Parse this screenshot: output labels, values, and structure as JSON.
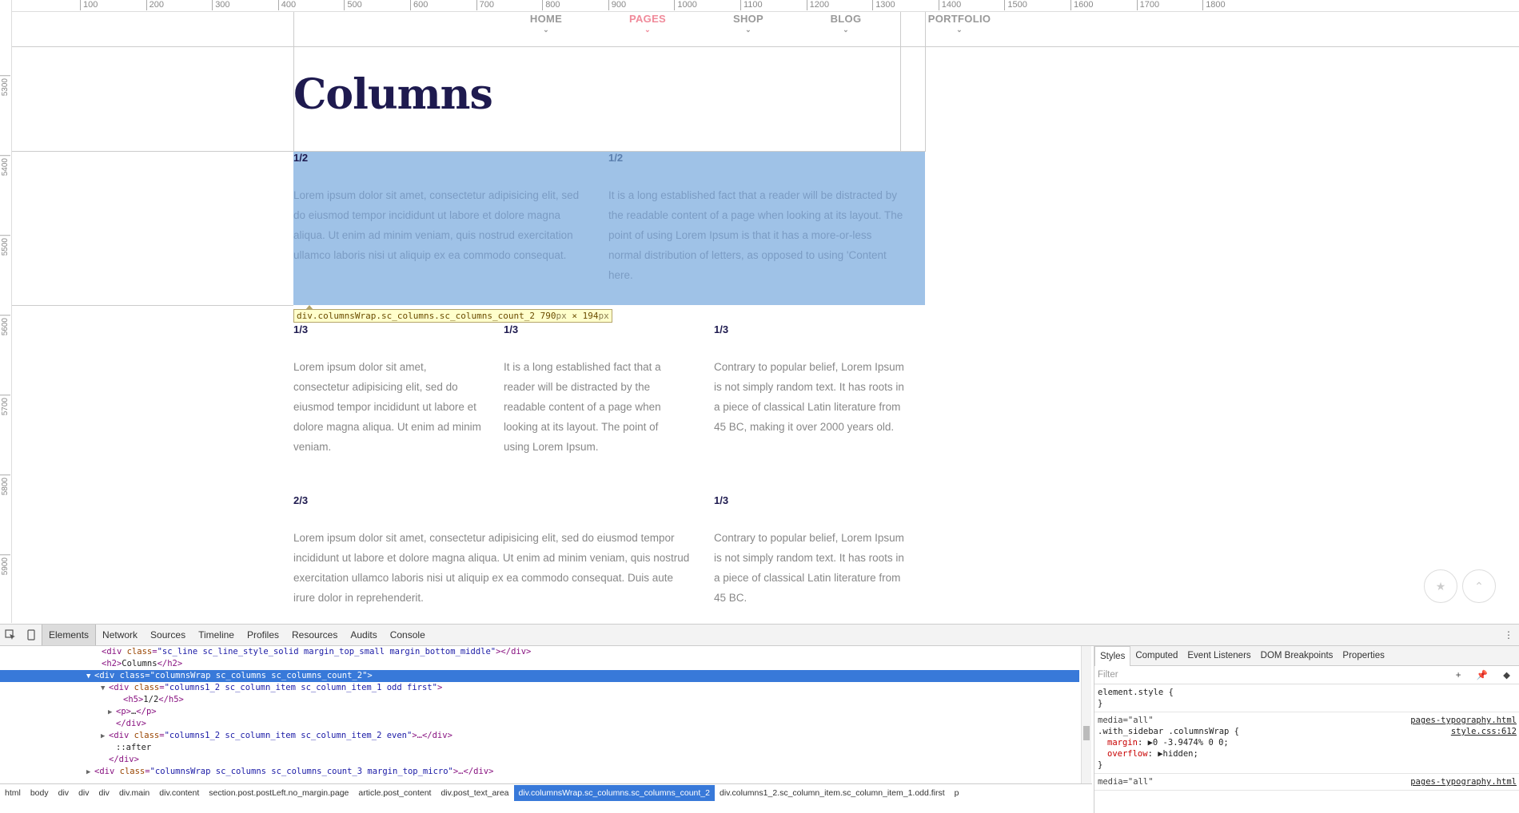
{
  "rulers": {
    "horizontal": [
      "100",
      "200",
      "300",
      "400",
      "500",
      "600",
      "700",
      "800",
      "900",
      "1000",
      "1100",
      "1200",
      "1300",
      "1400",
      "1500",
      "1600",
      "1700",
      "1800"
    ],
    "vertical": [
      "5300",
      "5400",
      "5500",
      "5600",
      "5700",
      "5800",
      "5900"
    ]
  },
  "nav": {
    "items": [
      {
        "label": "HOME",
        "active": false
      },
      {
        "label": "PAGES",
        "active": true
      },
      {
        "label": "SHOP",
        "active": false
      },
      {
        "label": "BLOG",
        "active": false
      },
      {
        "label": "PORTFOLIO",
        "active": false
      }
    ]
  },
  "content": {
    "title": "Columns",
    "row1": [
      {
        "heading": "1/2",
        "text": "Lorem ipsum dolor sit amet, consectetur adipisicing elit, sed do eiusmod tempor incididunt ut labore et dolore magna aliqua. Ut enim ad minim veniam, quis nostrud exercitation ullamco laboris nisi ut aliquip ex ea commodo consequat."
      },
      {
        "heading": "1/2",
        "text": "It is a long established fact that a reader will be distracted by the readable content of a page when looking at its layout. The point of using Lorem Ipsum is that it has a more-or-less normal distribution of letters, as opposed to using 'Content here."
      }
    ],
    "row2": [
      {
        "heading": "1/3",
        "text": "Lorem ipsum dolor sit amet, consectetur adipisicing elit, sed do eiusmod tempor incididunt ut labore et dolore magna aliqua. Ut enim ad minim veniam."
      },
      {
        "heading": "1/3",
        "text": "It is a long established fact that a reader will be distracted by the readable content of a page when looking at its layout. The point of using Lorem Ipsum."
      },
      {
        "heading": "1/3",
        "text": "Contrary to popular belief, Lorem Ipsum is not simply random text. It has roots in a piece of classical Latin literature from 45 BC, making it over 2000 years old."
      }
    ],
    "row3": [
      {
        "heading": "2/3",
        "text": "Lorem ipsum dolor sit amet, consectetur adipisicing elit, sed do eiusmod tempor incididunt ut labore et dolore magna aliqua. Ut enim ad minim veniam, quis nostrud exercitation ullamco laboris nisi ut aliquip ex ea commodo consequat. Duis aute irure dolor in reprehenderit."
      },
      {
        "heading": "1/3",
        "text": "Contrary to popular belief, Lorem Ipsum is not simply random text. It has roots in a piece of classical Latin literature from 45 BC."
      }
    ]
  },
  "tooltip": {
    "selector": "div.columnsWrap.sc_columns.sc_columns_count_2",
    "width": "790",
    "height": "194",
    "unit": "px",
    "times": "×"
  },
  "fab": {
    "star": "★",
    "up": "⌃"
  },
  "devtools": {
    "tabs": [
      "Elements",
      "Network",
      "Sources",
      "Timeline",
      "Profiles",
      "Resources",
      "Audits",
      "Console"
    ],
    "active_tab": "Elements",
    "menu": "⋮",
    "dom": [
      {
        "indent": 13,
        "tri": "",
        "html": "<span>&lt;div</span> <span class='attr-n'>class</span>=<span class='attr-v'>\"sc_line sc_line_style_solid  margin_top_small margin_bottom_middle\"</span><span>&gt;&lt;/div&gt;</span>"
      },
      {
        "indent": 13,
        "tri": "",
        "html": "<span>&lt;h2&gt;</span><span class='txt'>Columns</span><span>&lt;/h2&gt;</span>"
      },
      {
        "indent": 12,
        "tri": "▼",
        "selected": true,
        "html": "<span>&lt;div</span> <span class='attr-n'>class</span>=<span class='attr-v'>\"columnsWrap sc_columns sc_columns_count_2\"</span><span>&gt;</span>"
      },
      {
        "indent": 14,
        "tri": "▼",
        "html": "<span>&lt;div</span> <span class='attr-n'>class</span>=<span class='attr-v'>\"columns1_2 sc_column_item sc_column_item_1 odd first\"</span><span>&gt;</span>"
      },
      {
        "indent": 16,
        "tri": "",
        "html": "<span>&lt;h5&gt;</span><span class='txt'>1/2</span><span>&lt;/h5&gt;</span>"
      },
      {
        "indent": 15,
        "tri": "▶",
        "html": "<span>&lt;p&gt;</span><span class='txt'>…</span><span>&lt;/p&gt;</span>"
      },
      {
        "indent": 15,
        "tri": "",
        "html": "<span>&lt;/div&gt;</span>"
      },
      {
        "indent": 14,
        "tri": "▶",
        "html": "<span>&lt;div</span> <span class='attr-n'>class</span>=<span class='attr-v'>\"columns1_2 sc_column_item sc_column_item_2 even\"</span><span>&gt;…&lt;/div&gt;</span>"
      },
      {
        "indent": 15,
        "tri": "",
        "html": "<span class='txt'>::after</span>"
      },
      {
        "indent": 14,
        "tri": "",
        "html": "<span>&lt;/div&gt;</span>"
      },
      {
        "indent": 12,
        "tri": "▶",
        "html": "<span>&lt;div</span> <span class='attr-n'>class</span>=<span class='attr-v'>\"columnsWrap sc_columns sc_columns_count_3 margin_top_micro\"</span><span>&gt;…&lt;/div&gt;</span>"
      }
    ],
    "styles_tabs": [
      "Styles",
      "Computed",
      "Event Listeners",
      "DOM Breakpoints",
      "Properties"
    ],
    "filter_placeholder": "Filter",
    "filter_icons": "+ 📌 ◆",
    "rules": [
      {
        "media": "",
        "selector": "element.style {",
        "props": [],
        "close": "}",
        "src": ""
      },
      {
        "media": "media=\"all\"",
        "selector": ".with_sidebar .columnsWrap {",
        "props": [
          [
            "margin",
            "▶0 -3.9474% 0 0;"
          ],
          [
            "overflow",
            "▶hidden;"
          ]
        ],
        "close": "}",
        "src": "pages-typography.html",
        "src2": "style.css:612"
      },
      {
        "media": "media=\"all\"",
        "selector": "",
        "props": [],
        "close": "",
        "src": "pages-typography.html"
      }
    ],
    "breadcrumb": [
      "html",
      "body",
      "div",
      "div",
      "div",
      "div.main",
      "div.content",
      "section.post.postLeft.no_margin.page",
      "article.post_content",
      "div.post_text_area",
      "div.columnsWrap.sc_columns.sc_columns_count_2",
      "div.columns1_2.sc_column_item.sc_column_item_1.odd.first",
      "p"
    ],
    "breadcrumb_active": 10
  }
}
